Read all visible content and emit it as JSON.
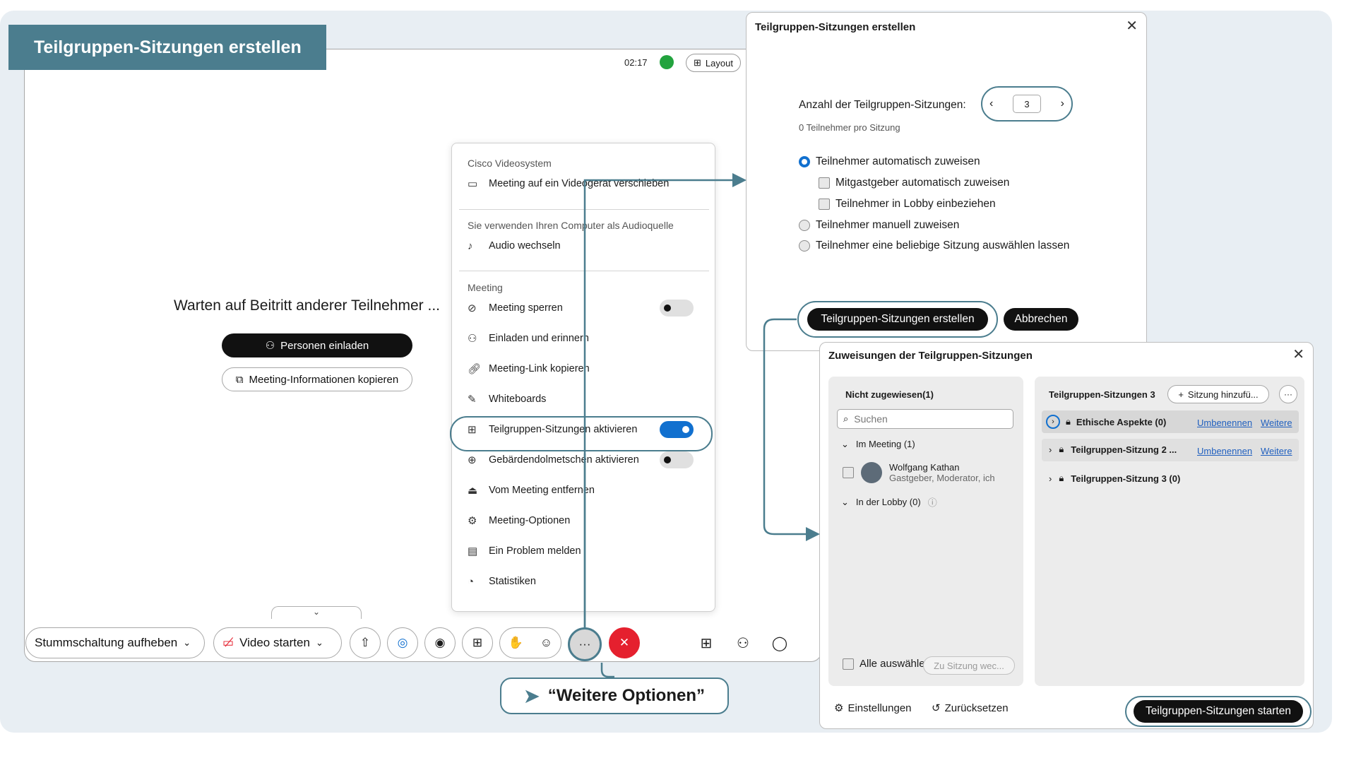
{
  "banner": {
    "title": "Teilgruppen-Sitzungen erstellen"
  },
  "topbar": {
    "time": "02:17",
    "layout_label": "Layout"
  },
  "stage": {
    "waiting_text": "Warten auf Beitritt anderer Teilnehmer ...",
    "invite_label": "Personen einladen",
    "copy_info_label": "Meeting-Informationen kopieren"
  },
  "toolbar": {
    "mute_label": "Stummschaltung aufheben",
    "video_label": "Video starten"
  },
  "menu": {
    "section_1": "Cisco Videosystem",
    "move_device": "Meeting auf ein Videogerät verschieben",
    "section_2": "Sie verwenden Ihren Computer als Audioquelle",
    "switch_audio": "Audio wechseln",
    "section_3": "Meeting",
    "items": [
      {
        "label": "Meeting sperren",
        "toggle": "off"
      },
      {
        "label": "Einladen und erinnern"
      },
      {
        "label": "Meeting-Link kopieren"
      },
      {
        "label": "Whiteboards"
      },
      {
        "label": "Teilgruppen-Sitzungen aktivieren",
        "toggle": "on"
      },
      {
        "label": "Gebärdendolmetschen aktivieren",
        "toggle": "off"
      },
      {
        "label": "Vom Meeting entfernen"
      },
      {
        "label": "Meeting-Optionen"
      },
      {
        "label": "Ein Problem melden"
      },
      {
        "label": "Statistiken"
      }
    ]
  },
  "dialog_create": {
    "title": "Teilgruppen-Sitzungen erstellen",
    "count_label": "Anzahl der Teilgruppen-Sitzungen:",
    "count_value": "3",
    "per_session": "0 Teilnehmer pro Sitzung",
    "opt_auto": "Teilnehmer automatisch zuweisen",
    "opt_cohost": "Mitgastgeber automatisch zuweisen",
    "opt_lobby": "Teilnehmer in Lobby einbeziehen",
    "opt_manual": "Teilnehmer manuell zuweisen",
    "opt_choose": "Teilnehmer eine beliebige Sitzung auswählen lassen",
    "create_button": "Teilgruppen-Sitzungen erstellen",
    "cancel_button": "Abbrechen"
  },
  "dialog_assign": {
    "title": "Zuweisungen der Teilgruppen-Sitzungen",
    "unassigned_header": "Nicht zugewiesen(1)",
    "search_placeholder": "Suchen",
    "in_meeting": "Im Meeting (1)",
    "participant_name": "Wolfgang Kathan",
    "participant_role": "Gastgeber, Moderator, ich",
    "in_lobby": "In der Lobby (0)",
    "select_all": "Alle auswählen",
    "move_to_session": "Zu Sitzung wec...",
    "sessions_header": "Teilgruppen-Sitzungen 3",
    "add_session": "Sitzung hinzufü...",
    "sessions": [
      {
        "name": "Ethische Aspekte (0)",
        "rename": "Umbenennen",
        "more": "Weitere"
      },
      {
        "name": "Teilgruppen-Sitzung 2 ...",
        "rename": "Umbenennen",
        "more": "Weitere"
      },
      {
        "name": "Teilgruppen-Sitzung 3 (0)"
      }
    ],
    "settings": "Einstellungen",
    "reset": "Zurücksetzen",
    "start_button": "Teilgruppen-Sitzungen starten"
  },
  "annotation": {
    "label": "“Weitere Optionen”"
  },
  "colors": {
    "accent": "#4b7d8e",
    "toggle_on": "#1170cf",
    "end_call": "#e5202e",
    "signal": "#22a33e"
  }
}
